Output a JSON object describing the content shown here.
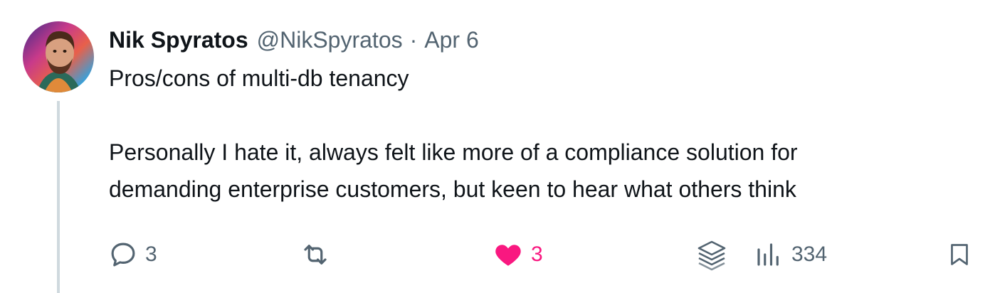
{
  "tweet": {
    "display_name": "Nik Spyratos",
    "handle": "@NikSpyratos",
    "separator": "·",
    "date": "Apr 6",
    "text_line1": "Pros/cons of multi-db tenancy",
    "text_line2": "Personally I hate it, always felt like more of a compliance solution for",
    "text_line3": "demanding enterprise customers, but keen to hear what others think"
  },
  "actions": {
    "reply_count": "3",
    "retweet_count": "",
    "like_count": "3",
    "views_count": "334"
  },
  "colors": {
    "text": "#0f1419",
    "secondary": "#536471",
    "like_pink": "#f91880",
    "thread_line": "#cfd9de"
  },
  "icons": [
    "reply-icon",
    "retweet-icon",
    "heart-icon",
    "grok-icon",
    "views-icon",
    "bookmark-icon"
  ]
}
